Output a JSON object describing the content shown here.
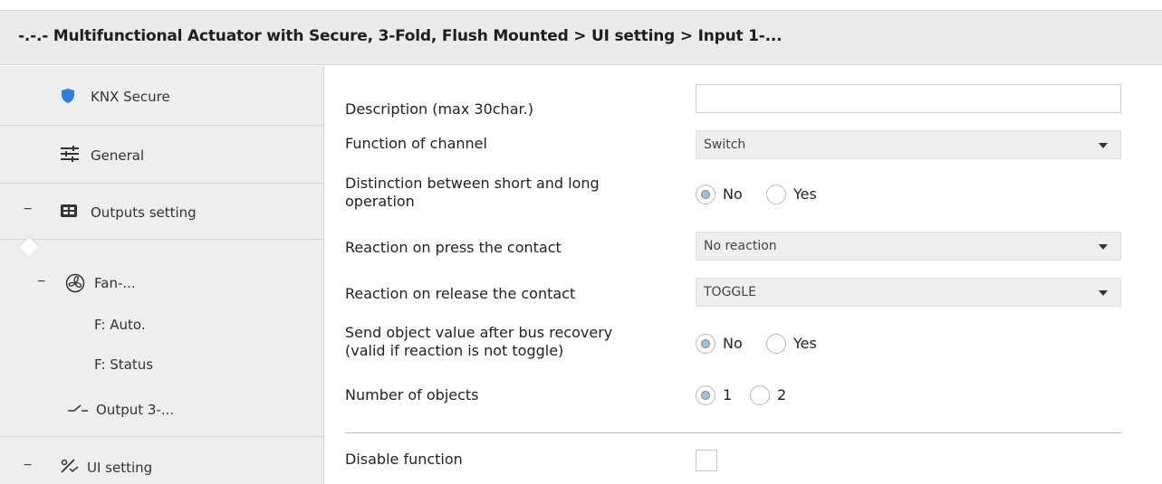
{
  "header": {
    "title": "-.-.- Multifunctional Actuator with Secure, 3-Fold, Flush Mounted > UI setting > Input 1-..."
  },
  "sidebar": {
    "items": [
      {
        "label": "KNX Secure",
        "icon": "shield-icon"
      },
      {
        "label": "General",
        "icon": "sliders-icon"
      },
      {
        "label": "Outputs setting",
        "icon": "outputs-icon",
        "collapse": "−"
      },
      {
        "label": "Fan-...",
        "icon": "fan-icon",
        "collapse": "−"
      },
      {
        "label": "F: Auto."
      },
      {
        "label": "F: Status"
      },
      {
        "label": "Output 3-...",
        "icon": "switch-icon"
      },
      {
        "label": "UI setting",
        "icon": "ui-setting-icon",
        "collapse": "−"
      }
    ]
  },
  "form": {
    "description": {
      "label": "Description (max 30char.)",
      "value": ""
    },
    "function_of_channel": {
      "label": "Function of channel",
      "value": "Switch"
    },
    "distinction": {
      "label_line1": "Distinction between short and long",
      "label_line2": "operation",
      "options": [
        "No",
        "Yes"
      ],
      "selected": "No"
    },
    "reaction_press": {
      "label": "Reaction on press the contact",
      "value": "No reaction"
    },
    "reaction_release": {
      "label": "Reaction on release the contact",
      "value": "TOGGLE"
    },
    "send_after_recovery": {
      "label_line1": "Send object value after bus recovery",
      "label_line2": "(valid if reaction is not toggle)",
      "options": [
        "No",
        "Yes"
      ],
      "selected": "No"
    },
    "number_of_objects": {
      "label": "Number of objects",
      "options": [
        "1",
        "2"
      ],
      "selected": "1"
    },
    "disable_function": {
      "label": "Disable function",
      "checked": false
    }
  },
  "colors": {
    "sidebar_bg": "#eeeeee",
    "header_bg": "#ebebeb",
    "shield": "#2f7fd8",
    "radio_selected": "#a8bdd6"
  }
}
